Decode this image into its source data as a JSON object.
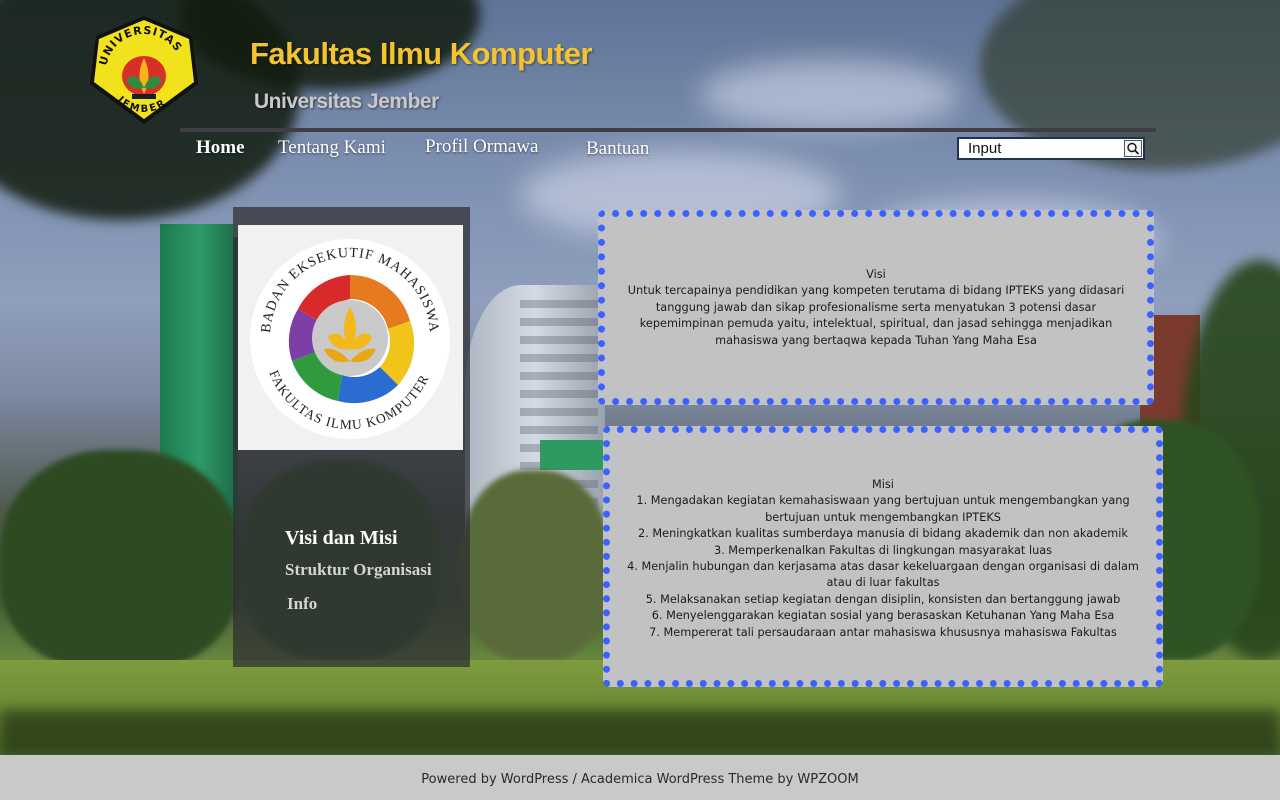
{
  "header": {
    "title": "Fakultas Ilmu Komputer",
    "subtitle": "Universitas Jember",
    "logo_text_top": "UNIVERSITAS",
    "logo_text_bottom": "JEMBER"
  },
  "nav": {
    "items": [
      {
        "label": "Home",
        "active": true
      },
      {
        "label": "Tentang Kami",
        "active": false
      },
      {
        "label": "Profil Ormawa",
        "active": false
      },
      {
        "label": "Bantuan",
        "active": false
      }
    ]
  },
  "search": {
    "value": "Input",
    "icon": "search-icon"
  },
  "sidebar": {
    "logo_text_top": "BADAN EKSEKUTIF MAHASISWA",
    "logo_text_bottom": "FAKULTAS ILMU KOMPUTER",
    "links": [
      {
        "label": "Visi dan Misi"
      },
      {
        "label": "Struktur Organisasi"
      },
      {
        "label": "Info"
      }
    ]
  },
  "visi": {
    "heading": "Visi",
    "body": "Untuk tercapainya pendidikan yang kompeten terutama di bidang IPTEKS yang didasari tanggung jawab dan sikap profesionalisme serta menyatukan 3 potensi dasar kepemimpinan pemuda yaitu, intelektual, spiritual, dan jasad sehingga menjadikan mahasiswa yang bertaqwa kepada Tuhan Yang Maha Esa"
  },
  "misi": {
    "heading": "Misi",
    "items": [
      "1. Mengadakan kegiatan kemahasiswaan yang bertujuan untuk mengembangkan yang bertujuan untuk mengembangkan IPTEKS",
      "2. Meningkatkan kualitas sumberdaya manusia di bidang akademik dan non akademik",
      "3. Memperkenalkan Fakultas di lingkungan masyarakat luas",
      "4. Menjalin hubungan dan kerjasama atas dasar kekeluargaan dengan organisasi di dalam atau di luar fakultas",
      "5. Melaksanakan setiap kegiatan dengan disiplin, konsisten dan bertanggung jawab",
      "6. Menyelenggarakan kegiatan sosial yang berasaskan Ketuhanan Yang Maha Esa",
      "7. Mempererat tali persaudaraan antar mahasiswa khususnya mahasiswa Fakultas"
    ]
  },
  "footer": {
    "text": "Powered by WordPress / Academica WordPress Theme by WPZOOM"
  },
  "colors": {
    "title": "#f4c430",
    "panel_border": "#3a62ff",
    "panel_bg": "#c2c2c4",
    "footer_bg": "#c9c9c9"
  }
}
